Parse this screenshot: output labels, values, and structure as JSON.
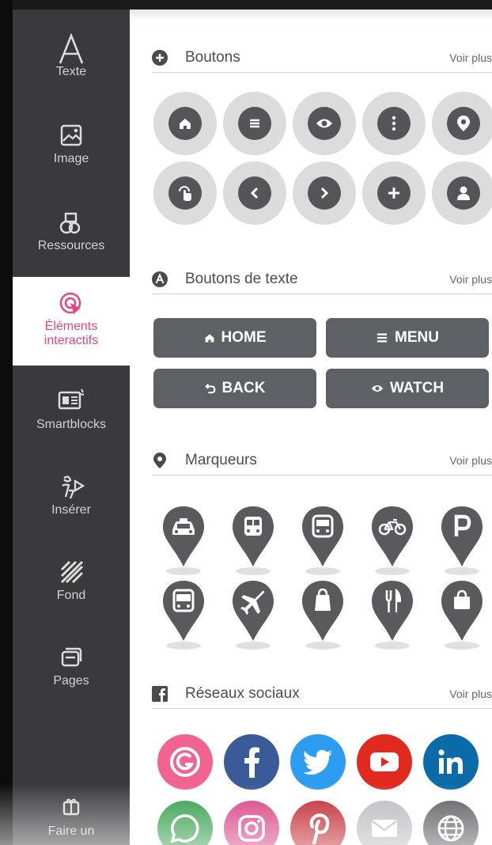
{
  "sidebar": {
    "items": [
      {
        "label": "Texte",
        "icon": "text-A-icon"
      },
      {
        "label": "Image",
        "icon": "image-icon"
      },
      {
        "label": "Ressources",
        "icon": "shapes-icon"
      },
      {
        "label": "Éléments interactifs",
        "icon": "interactive-cursor-icon"
      },
      {
        "label": "Smartblocks",
        "icon": "smartblock-icon"
      },
      {
        "label": "Insérer",
        "icon": "insert-icon"
      },
      {
        "label": "Fond",
        "icon": "background-hatch-icon"
      },
      {
        "label": "Pages",
        "icon": "pages-icon"
      },
      {
        "label": "Faire un",
        "icon": "gift-icon"
      }
    ],
    "active_index": 3,
    "active_color": "#e8437e"
  },
  "sections": {
    "buttons": {
      "title": "Boutons",
      "more": "Voir plus",
      "icon": "plus-circle-icon"
    },
    "text_buttons": {
      "title": "Boutons de texte",
      "more": "Voir plus",
      "icon": "letter-a-circle-icon"
    },
    "markers": {
      "title": "Marqueurs",
      "more": "Voir plus",
      "icon": "map-pin-icon"
    },
    "social": {
      "title": "Réseaux sociaux",
      "more": "Voir plus",
      "icon": "facebook-square-icon"
    }
  },
  "round_buttons": [
    "home-icon",
    "menu-icon",
    "eye-icon",
    "more-vertical-icon",
    "location-pin-icon",
    "touch-icon",
    "chevron-left-icon",
    "chevron-right-icon",
    "plus-icon",
    "user-icon"
  ],
  "text_buttons": [
    {
      "label": "HOME",
      "icon": "home-icon"
    },
    {
      "label": "MENU",
      "icon": "menu-icon"
    },
    {
      "label": "BACK",
      "icon": "back-arrow-icon"
    },
    {
      "label": "WATCH",
      "icon": "eye-icon"
    }
  ],
  "markers": [
    "car-icon",
    "train-icon",
    "bus-front-icon",
    "bicycle-icon",
    "parking-icon",
    "bus-icon",
    "plane-icon",
    "shopping-bag-icon",
    "restaurant-icon",
    "bag-icon"
  ],
  "social": [
    {
      "name": "genially",
      "color": "#f0648f"
    },
    {
      "name": "facebook",
      "color": "#3a5a98"
    },
    {
      "name": "twitter",
      "color": "#2e9cf0"
    },
    {
      "name": "youtube",
      "color": "#e02a20"
    },
    {
      "name": "linkedin",
      "color": "#0b6aa8"
    },
    {
      "name": "whatsapp",
      "color": "#2b9a45"
    },
    {
      "name": "instagram",
      "color": "#d63a7f"
    },
    {
      "name": "pinterest",
      "color": "#c0202a"
    },
    {
      "name": "email",
      "color": "#b9b9bc"
    },
    {
      "name": "web",
      "color": "#58585b"
    }
  ]
}
